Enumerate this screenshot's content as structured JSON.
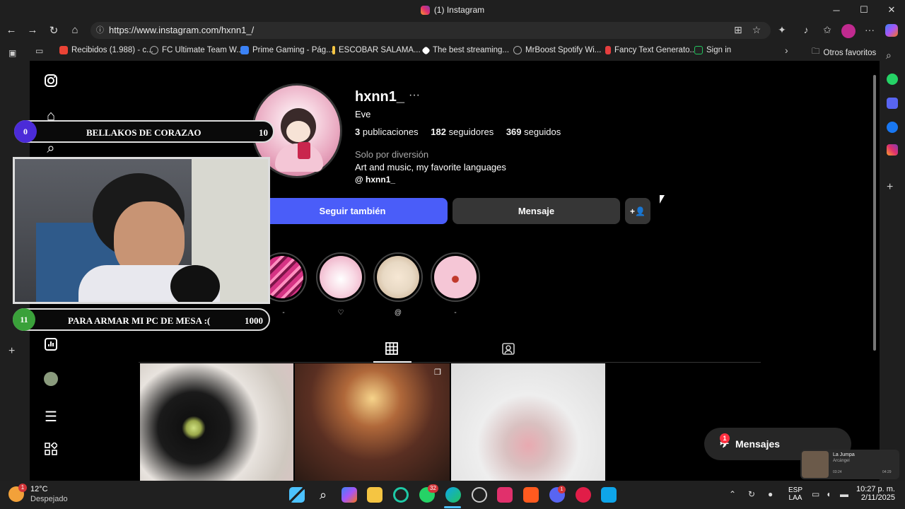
{
  "window": {
    "tab_title": "(1) Instagram",
    "minimize": "─",
    "maximize": "☐",
    "close": "✕"
  },
  "nav": {
    "back": "←",
    "forward": "→",
    "reload": "↻",
    "home": "⌂",
    "url": "https://www.instagram.com/hxnn1_/"
  },
  "bookmarks": [
    {
      "label": "Recibidos (1.988) - c...",
      "color": "#ea4335"
    },
    {
      "label": "FC Ultimate Team W...",
      "color": "#888888"
    },
    {
      "label": "Prime Gaming - Pág...",
      "color": "#3b82f6"
    },
    {
      "label": "ESCOBAR SALAMA...",
      "color": "#f5c542"
    },
    {
      "label": "The best streaming...",
      "color": "#ffffff"
    },
    {
      "label": "MrBoost Spotify Wi...",
      "color": "#888888"
    },
    {
      "label": "Fancy Text Generato...",
      "color": "#e53e3e"
    },
    {
      "label": "Sign in",
      "color": "#22c55e"
    }
  ],
  "bookmarks_more": "›",
  "other_favorites": "Otros favoritos",
  "profile": {
    "username": "hxnn1_",
    "more": "···",
    "full_name": "Eve",
    "posts_count": "3",
    "posts_label": "publicaciones",
    "followers_count": "182",
    "followers_label": "seguidores",
    "following_count": "369",
    "following_label": "seguidos",
    "bio_line1": "Solo por diversión",
    "bio_line2": "Art and music, my favorite languages",
    "threads_handle": "hxnn1_",
    "follow_button": "Seguir también",
    "message_button": "Mensaje",
    "suggest_icon": "+👤"
  },
  "highlights": [
    {
      "label": "-",
      "color": "#d63384"
    },
    {
      "label": "♡",
      "color": "#f8d7e3"
    },
    {
      "label": "@",
      "color": "#e8d9c4"
    },
    {
      "label": "-",
      "color": "#f5c6d6"
    }
  ],
  "overlay": {
    "goal1": {
      "current": "0",
      "label": "BELLAKOS DE CORAZAO",
      "target": "10"
    },
    "goal2": {
      "current": "11",
      "label": "PARA ARMAR MI PC DE MESA :(",
      "target": "1000"
    }
  },
  "messages_pill": {
    "label": "Mensajes",
    "badge": "1"
  },
  "media": {
    "title": "La Jumpa",
    "artist": "Arcángel",
    "elapsed": "03:24",
    "total": "04:29"
  },
  "taskbar": {
    "weather_temp": "12°C",
    "weather_desc": "Despejado",
    "weather_badge": "1",
    "whatsapp_badge": "32",
    "discord_badge": "1",
    "lang1": "ESP",
    "lang2": "LAA",
    "time": "10:27 p. m.",
    "date": "2/11/2025"
  }
}
